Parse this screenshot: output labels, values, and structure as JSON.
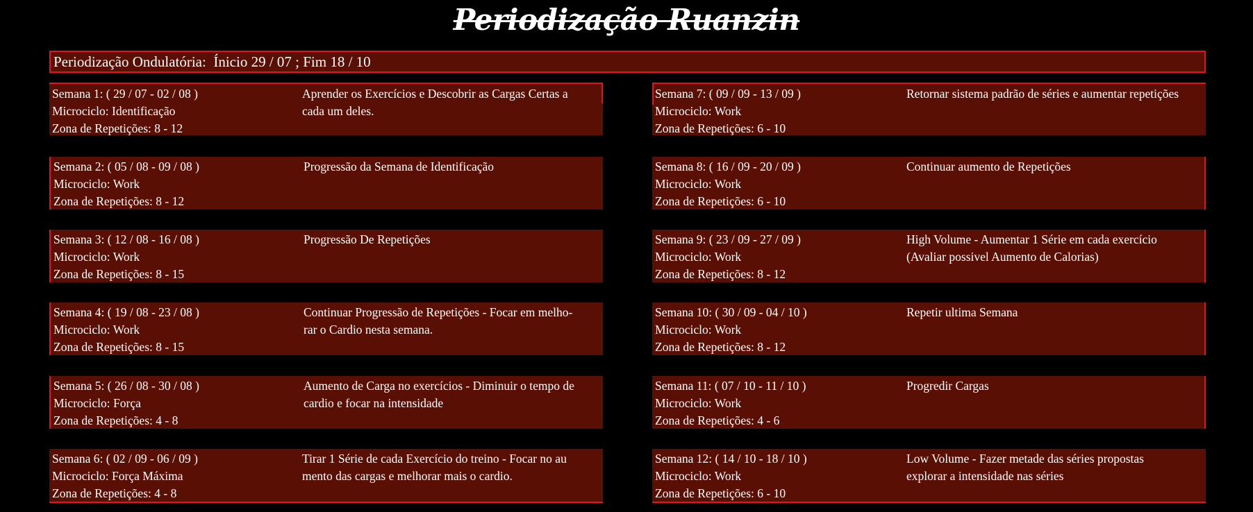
{
  "title": "Periodização Ruanzin",
  "banner": "Periodização Ondulatória:  Ínicio 29 / 07 ; Fim 18 / 10",
  "weeks_left": [
    {
      "semana": "Semana 1: ( 29 / 07 - 02 / 08 )",
      "micro": "Microciclo: Identificação",
      "zona": "Zona de Repetições: 8 - 12",
      "nota": "Aprender os Exercícios e Descobrir as Cargas Certas a\ncada um deles."
    },
    {
      "semana": "Semana 2: ( 05 / 08 - 09 / 08 )",
      "micro": "Microciclo: Work",
      "zona": "Zona de Repetições: 8 - 12",
      "nota": "Progressão da Semana de Identificação"
    },
    {
      "semana": "Semana 3: ( 12 / 08 - 16 / 08 )",
      "micro": "Microciclo: Work",
      "zona": "Zona de Repetições: 8 - 15",
      "nota": "Progressão De Repetições"
    },
    {
      "semana": "Semana 4: ( 19 / 08 - 23 / 08 )",
      "micro": "Microciclo: Work",
      "zona": "Zona de Repetições: 8 - 15",
      "nota": "Continuar Progressão de Repetições - Focar em melho-\nrar o Cardio nesta semana."
    },
    {
      "semana": "Semana 5: ( 26 / 08 - 30 / 08 )",
      "micro": "Microciclo: Força",
      "zona": "Zona de Repetições: 4 - 8",
      "nota": "Aumento de Carga no exercícios - Diminuir o tempo de\ncardio e focar na intensidade"
    },
    {
      "semana": "Semana 6: ( 02 / 09 - 06 / 09 )",
      "micro": "Microciclo: Força Máxima",
      "zona": "Zona de Repetições: 4 - 8",
      "nota": "Tirar 1 Série de cada Exercício do treino - Focar no au\nmento das cargas e melhorar mais o cardio."
    }
  ],
  "weeks_right": [
    {
      "semana": "Semana 7: ( 09 / 09 - 13 / 09 )",
      "micro": "Microciclo: Work",
      "zona": "Zona de Repetições: 6 - 10",
      "nota": "Retornar sistema padrão de séries e aumentar repetições"
    },
    {
      "semana": "Semana 8: ( 16 / 09 - 20 / 09 )",
      "micro": "Microciclo: Work",
      "zona": "Zona de Repetições: 6 - 10",
      "nota": "Continuar aumento de Repetições"
    },
    {
      "semana": "Semana 9: ( 23 / 09 - 27 / 09 )",
      "micro": "Microciclo: Work",
      "zona": "Zona de Repetições: 8 - 12",
      "nota": "High Volume - Aumentar 1 Série em cada exercício\n(Avaliar possivel Aumento de Calorias)"
    },
    {
      "semana": "Semana 10: ( 30 / 09 - 04 / 10 )",
      "micro": "Microciclo: Work",
      "zona": "Zona de Repetições: 8 - 12",
      "nota": "Repetir ultima Semana"
    },
    {
      "semana": "Semana 11: ( 07 / 10 - 11 / 10 )",
      "micro": "Microciclo: Work",
      "zona": "Zona de Repetições: 4 - 6",
      "nota": "Progredir Cargas"
    },
    {
      "semana": "Semana 12: ( 14 / 10 - 18 / 10 )",
      "micro": "Microciclo: Work",
      "zona": "Zona de Repetições: 6 - 10",
      "nota": "Low Volume - Fazer metade das séries propostas\nexplorar a intensidade nas séries"
    }
  ]
}
